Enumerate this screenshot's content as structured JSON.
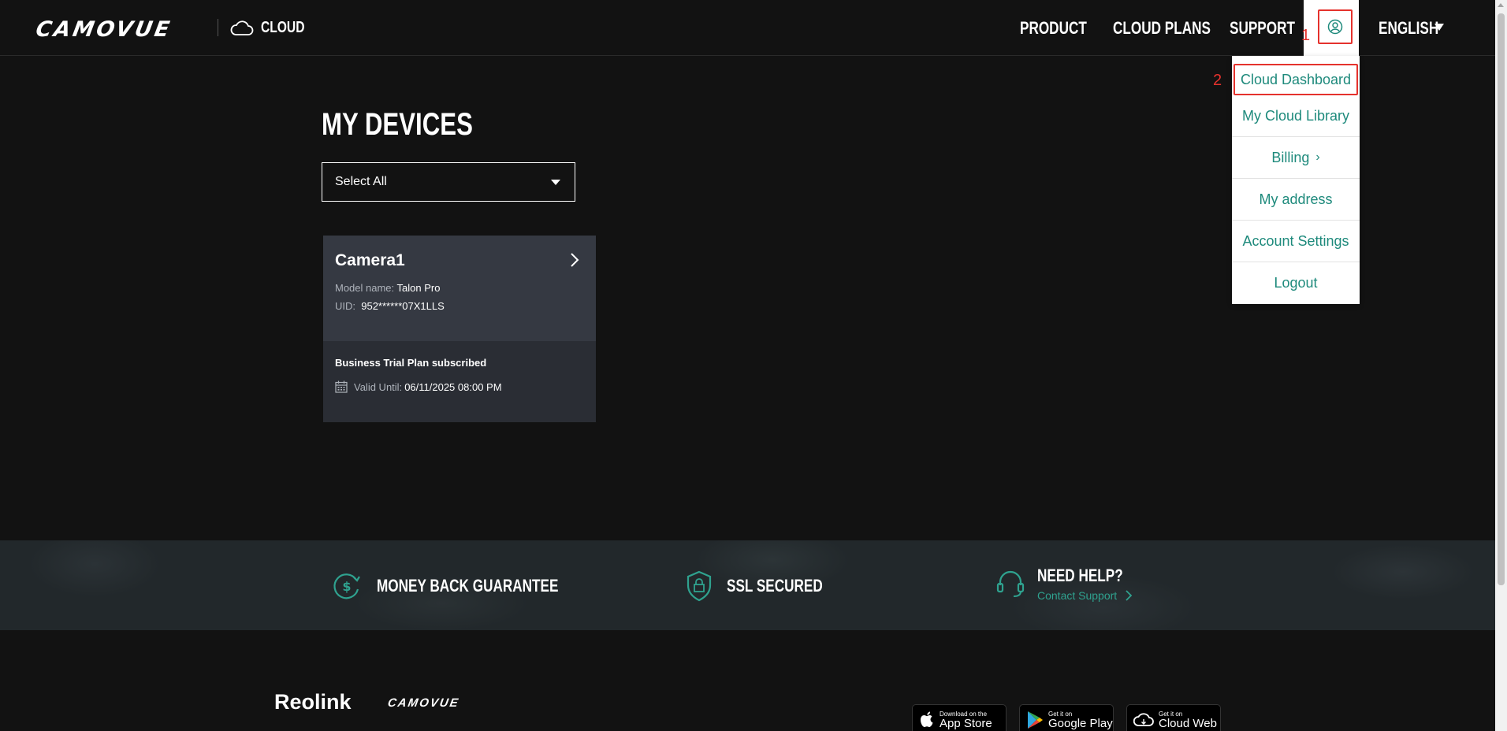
{
  "header": {
    "logo": "CAMOVUE",
    "cloud_label": "CLOUD",
    "nav": [
      {
        "label": "PRODUCT"
      },
      {
        "label": "CLOUD PLANS"
      },
      {
        "label": "SUPPORT"
      }
    ],
    "language": "ENGLISH",
    "annotation_user": "1",
    "annotation_menu": "2"
  },
  "user_menu": {
    "items": [
      {
        "label": "Cloud Dashboard"
      },
      {
        "label": "My Cloud Library"
      },
      {
        "label": "Billing"
      },
      {
        "label": "My address"
      },
      {
        "label": "Account Settings"
      },
      {
        "label": "Logout"
      }
    ]
  },
  "main": {
    "title": "MY DEVICES",
    "filter_value": "Select All",
    "device": {
      "name": "Camera1",
      "model_label": "Model name:",
      "model_value": "Talon Pro",
      "uid_label": "UID:",
      "uid_value": "952******07X1LLS",
      "plan": "Business Trial Plan subscribed",
      "valid_label": "Valid Until:",
      "valid_value": "06/11/2025 08:00 PM"
    }
  },
  "features": {
    "money_back": "MONEY BACK GUARANTEE",
    "ssl": "SSL SECURED",
    "help_title": "NEED HELP?",
    "help_link": "Contact Support"
  },
  "footer": {
    "brand1": "Reolink",
    "brand2": "CAMOVUE",
    "stores": [
      {
        "small": "Download on the",
        "big": "App Store"
      },
      {
        "small": "Get it on",
        "big": "Google Play"
      },
      {
        "small": "Get it on",
        "big": "Cloud Web"
      }
    ]
  },
  "colors": {
    "accent_teal": "#1e8a7c",
    "highlight_red": "#e5322d",
    "background": "#121212"
  }
}
